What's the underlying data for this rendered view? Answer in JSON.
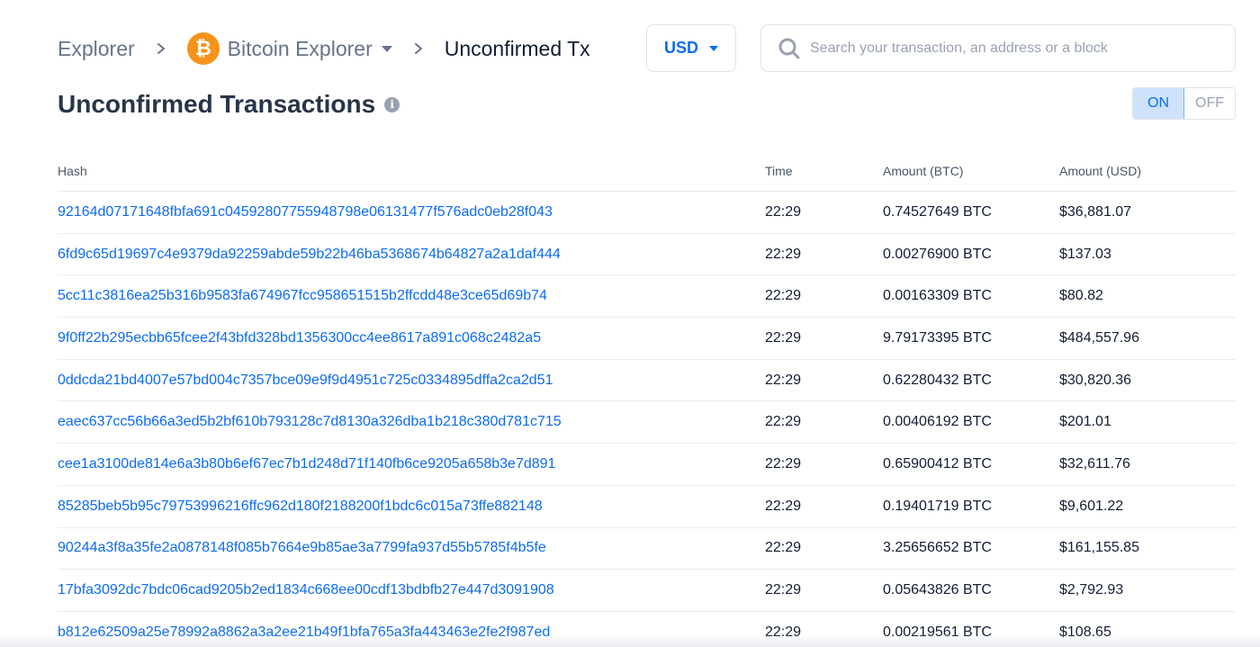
{
  "breadcrumb": {
    "root": "Explorer",
    "explorer": "Bitcoin Explorer",
    "current": "Unconfirmed Tx",
    "coin_symbol": "₿"
  },
  "currency": {
    "selected": "USD"
  },
  "search": {
    "placeholder": "Search your transaction, an address or a block"
  },
  "page": {
    "title": "Unconfirmed Transactions"
  },
  "toggle": {
    "on_label": "ON",
    "off_label": "OFF",
    "active": "ON"
  },
  "table": {
    "headers": {
      "hash": "Hash",
      "time": "Time",
      "btc": "Amount (BTC)",
      "usd": "Amount (USD)"
    },
    "rows": [
      {
        "hash": "92164d07171648fbfa691c04592807755948798e06131477f576adc0eb28f043",
        "time": "22:29",
        "btc": "0.74527649 BTC",
        "usd": "$36,881.07"
      },
      {
        "hash": "6fd9c65d19697c4e9379da92259abde59b22b46ba5368674b64827a2a1daf444",
        "time": "22:29",
        "btc": "0.00276900 BTC",
        "usd": "$137.03"
      },
      {
        "hash": "5cc11c3816ea25b316b9583fa674967fcc958651515b2ffcdd48e3ce65d69b74",
        "time": "22:29",
        "btc": "0.00163309 BTC",
        "usd": "$80.82"
      },
      {
        "hash": "9f0ff22b295ecbb65fcee2f43bfd328bd1356300cc4ee8617a891c068c2482a5",
        "time": "22:29",
        "btc": "9.79173395 BTC",
        "usd": "$484,557.96"
      },
      {
        "hash": "0ddcda21bd4007e57bd004c7357bce09e9f9d4951c725c0334895dffa2ca2d51",
        "time": "22:29",
        "btc": "0.62280432 BTC",
        "usd": "$30,820.36"
      },
      {
        "hash": "eaec637cc56b66a3ed5b2bf610b793128c7d8130a326dba1b218c380d781c715",
        "time": "22:29",
        "btc": "0.00406192 BTC",
        "usd": "$201.01"
      },
      {
        "hash": "cee1a3100de814e6a3b80b6ef67ec7b1d248d71f140fb6ce9205a658b3e7d891",
        "time": "22:29",
        "btc": "0.65900412 BTC",
        "usd": "$32,611.76"
      },
      {
        "hash": "85285beb5b95c79753996216ffc962d180f2188200f1bdc6c015a73ffe882148",
        "time": "22:29",
        "btc": "0.19401719 BTC",
        "usd": "$9,601.22"
      },
      {
        "hash": "90244a3f8a35fe2a0878148f085b7664e9b85ae3a7799fa937d55b5785f4b5fe",
        "time": "22:29",
        "btc": "3.25656652 BTC",
        "usd": "$161,155.85"
      },
      {
        "hash": "17bfa3092dc7bdc06cad9205b2ed1834c668ee00cdf13bdbfb27e447d3091908",
        "time": "22:29",
        "btc": "0.05643826 BTC",
        "usd": "$2,792.93"
      },
      {
        "hash": "b812e62509a25e78992a8862a3a2ee21b49f1bfa765a3fa443463e2fe2f987ed",
        "time": "22:29",
        "btc": "0.00219561 BTC",
        "usd": "$108.65"
      }
    ]
  },
  "colors": {
    "accent": "#0c6cf2",
    "bitcoin": "#f7931a",
    "muted": "#677389"
  },
  "icons": {
    "search": "search-icon",
    "info": "info-icon",
    "chevron": "chevron-right-icon",
    "coin": "bitcoin-logo-icon"
  }
}
